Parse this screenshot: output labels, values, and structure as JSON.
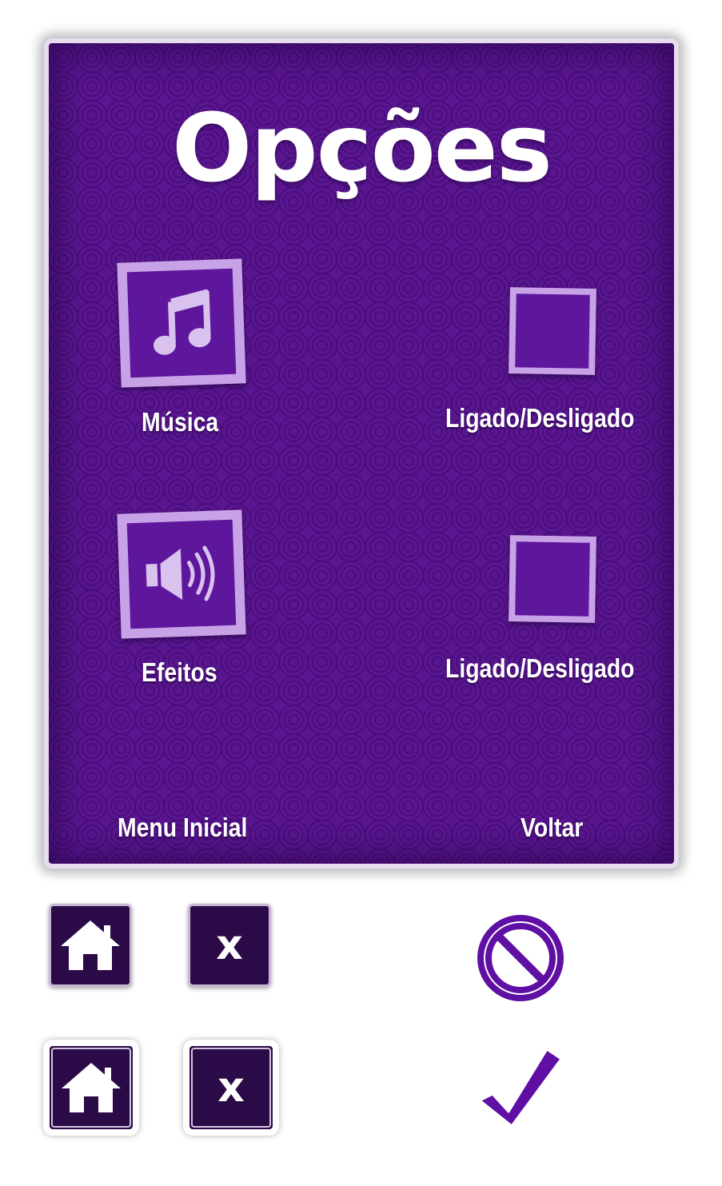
{
  "options_panel": {
    "title": "Opções",
    "music": {
      "label": "Música",
      "icon": "music-note-icon",
      "toggle_label": "Ligado/Desligado"
    },
    "effects": {
      "label": "Efeitos",
      "icon": "speaker-icon",
      "toggle_label": "Ligado/Desligado"
    },
    "footer": {
      "menu_label": "Menu Inicial",
      "back_label": "Voltar"
    }
  },
  "sprites": {
    "buttons": [
      {
        "icon": "home-icon"
      },
      {
        "icon": "close-icon",
        "glyph": "x"
      },
      {
        "icon": "home-icon"
      },
      {
        "icon": "close-icon",
        "glyph": "x"
      }
    ],
    "status_icons": [
      "prohibited-icon",
      "checkmark-icon"
    ]
  },
  "colors": {
    "panel_purple": "#5a1690",
    "tile_light": "#c8a2e6",
    "button_dark": "#2a0a47",
    "accent_purple": "#5f0fa3"
  }
}
